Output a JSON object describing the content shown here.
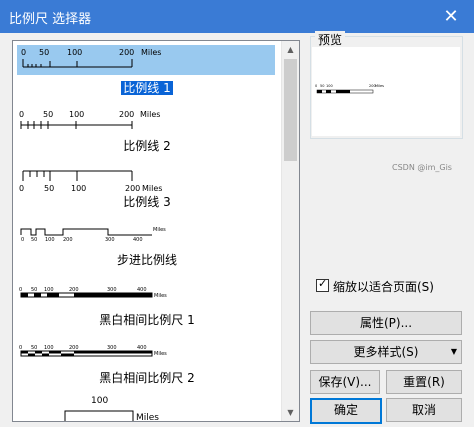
{
  "window": {
    "title": "比例尺 选择器",
    "close_glyph": "✕"
  },
  "list": {
    "items": [
      {
        "label": "比例线 1",
        "ticks": [
          "0",
          "50",
          "100",
          "200"
        ],
        "unit": "Miles",
        "selected": true
      },
      {
        "label": "比例线 2",
        "ticks": [
          "0",
          "50",
          "100",
          "200"
        ],
        "unit": "Miles"
      },
      {
        "label": "比例线 3",
        "ticks": [
          "0",
          "50",
          "100",
          "200"
        ],
        "unit": "Miles"
      },
      {
        "label": "步进比例线",
        "ticks": [
          "0",
          "50",
          "100",
          "200",
          "300",
          "400"
        ],
        "unit": "Miles"
      },
      {
        "label": "黑白相间比例尺 1",
        "ticks": [
          "0",
          "50",
          "100",
          "200",
          "300",
          "400"
        ],
        "unit": "Miles"
      },
      {
        "label": "黑白相间比例尺 2",
        "ticks": [
          "0",
          "50",
          "100",
          "200",
          "300",
          "400"
        ],
        "unit": "Miles"
      },
      {
        "label": "",
        "ticks": [
          "100"
        ],
        "unit": "Miles"
      }
    ]
  },
  "preview": {
    "title": "预览",
    "ticks": [
      "0",
      "50",
      "100",
      "200"
    ],
    "unit": "Miles"
  },
  "watermark": "CSDN @im_Gis",
  "options": {
    "fit_label": "缩放以适合页面(S)",
    "fit_checked": true,
    "check_glyph": "✓"
  },
  "buttons": {
    "properties": "属性(P)...",
    "more_styles": "更多样式(S)",
    "save": "保存(V)...",
    "reset": "重置(R)",
    "ok": "确定",
    "cancel": "取消"
  },
  "icons": {
    "scroll_up": "▲",
    "scroll_down": "▼",
    "dropdown": "▼"
  }
}
